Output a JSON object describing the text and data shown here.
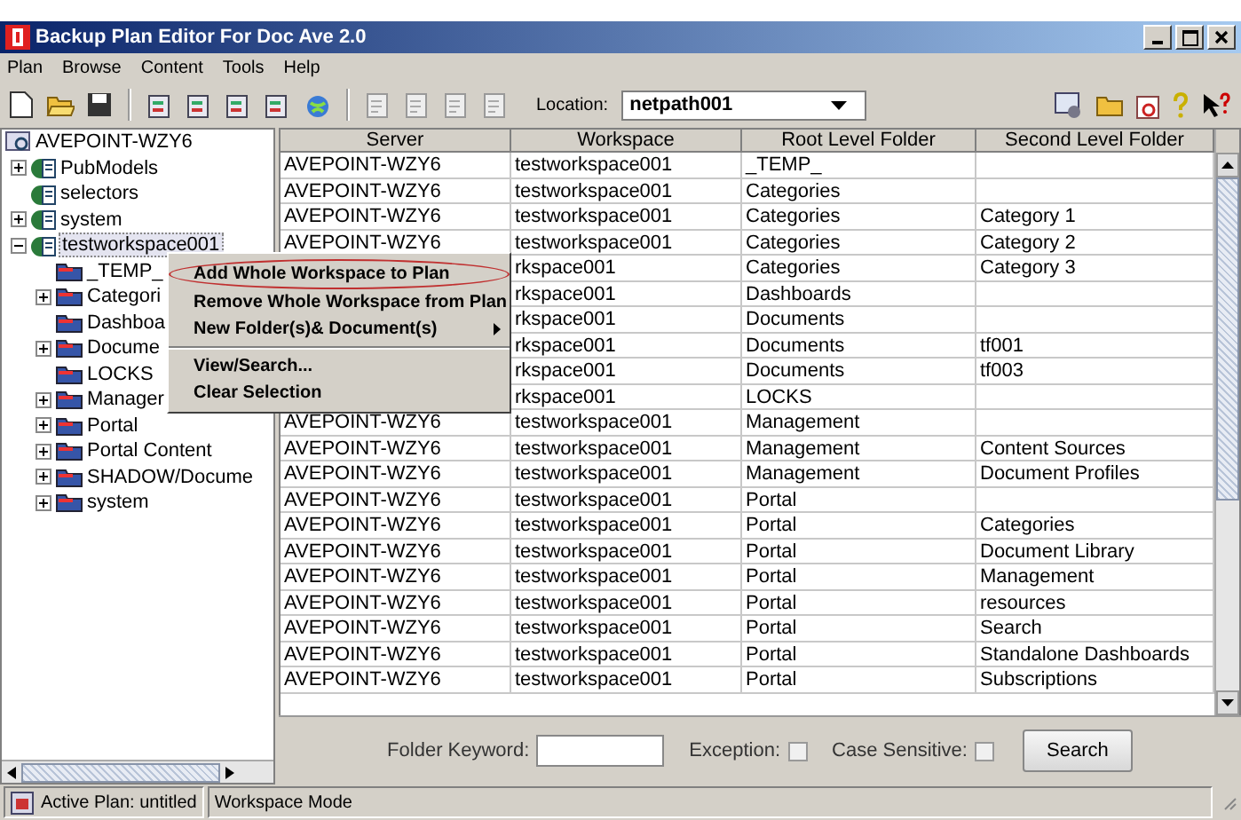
{
  "window": {
    "title": "Backup Plan Editor For Doc Ave 2.0"
  },
  "menu": [
    "Plan",
    "Browse",
    "Content",
    "Tools",
    "Help"
  ],
  "toolbar": {
    "location_label": "Location:",
    "location_value": "netpath001"
  },
  "tree": {
    "label": "AVEPOINT-WZY6",
    "selected": false,
    "children": [
      {
        "label": "PubModels",
        "kind": "workspace",
        "selected": false,
        "expanded": false
      },
      {
        "label": "selectors",
        "kind": "workspace",
        "selected": false
      },
      {
        "label": "system",
        "kind": "workspace",
        "selected": false,
        "expanded": false
      },
      {
        "label": "testworkspace001",
        "kind": "workspace",
        "selected": true,
        "expanded": true,
        "children": [
          {
            "label": "_TEMP_",
            "kind": "folder",
            "selected": false
          },
          {
            "label": "Categori",
            "kind": "folder",
            "selected": false,
            "expanded": false
          },
          {
            "label": "Dashboa",
            "kind": "folder",
            "selected": false
          },
          {
            "label": "Docume",
            "kind": "folder",
            "selected": false,
            "expanded": false
          },
          {
            "label": "LOCKS",
            "kind": "folder",
            "selected": false
          },
          {
            "label": "Manager",
            "kind": "folder",
            "selected": false,
            "expanded": false
          },
          {
            "label": "Portal",
            "kind": "folder",
            "selected": false,
            "expanded": false
          },
          {
            "label": "Portal Content",
            "kind": "folder",
            "selected": false,
            "expanded": false
          },
          {
            "label": "SHADOW/Docume",
            "kind": "folder",
            "selected": false,
            "expanded": false
          },
          {
            "label": "system",
            "kind": "folder",
            "selected": false,
            "expanded": false
          }
        ]
      }
    ]
  },
  "table": {
    "columns": [
      "Server",
      "Workspace",
      "Root Level Folder",
      "Second Level Folder"
    ],
    "rows": [
      {
        "server": "AVEPOINT-WZY6",
        "workspace": "testworkspace001",
        "root": "_TEMP_"
      },
      {
        "server": "AVEPOINT-WZY6",
        "workspace": "testworkspace001",
        "root": "Categories"
      },
      {
        "server": "AVEPOINT-WZY6",
        "workspace": "testworkspace001",
        "root": "Categories",
        "second": "Category 1"
      },
      {
        "server": "AVEPOINT-WZY6",
        "workspace": "testworkspace001",
        "root": "Categories",
        "second": "Category 2"
      },
      {
        "workspace": "rkspace001",
        "root": "Categories",
        "second": "Category 3"
      },
      {
        "workspace": "rkspace001",
        "root": "Dashboards"
      },
      {
        "workspace": "rkspace001",
        "root": "Documents"
      },
      {
        "workspace": "rkspace001",
        "root": "Documents",
        "second": "tf001"
      },
      {
        "workspace": "rkspace001",
        "root": "Documents",
        "second": "tf003"
      },
      {
        "workspace": "rkspace001",
        "root": "LOCKS"
      },
      {
        "server": "AVEPOINT-WZY6",
        "workspace": "testworkspace001",
        "root": "Management"
      },
      {
        "server": "AVEPOINT-WZY6",
        "workspace": "testworkspace001",
        "root": "Management",
        "second": "Content Sources"
      },
      {
        "server": "AVEPOINT-WZY6",
        "workspace": "testworkspace001",
        "root": "Management",
        "second": "Document Profiles"
      },
      {
        "server": "AVEPOINT-WZY6",
        "workspace": "testworkspace001",
        "root": "Portal"
      },
      {
        "server": "AVEPOINT-WZY6",
        "workspace": "testworkspace001",
        "root": "Portal",
        "second": "Categories"
      },
      {
        "server": "AVEPOINT-WZY6",
        "workspace": "testworkspace001",
        "root": "Portal",
        "second": "Document Library"
      },
      {
        "server": "AVEPOINT-WZY6",
        "workspace": "testworkspace001",
        "root": "Portal",
        "second": "Management"
      },
      {
        "server": "AVEPOINT-WZY6",
        "workspace": "testworkspace001",
        "root": "Portal",
        "second": "resources"
      },
      {
        "server": "AVEPOINT-WZY6",
        "workspace": "testworkspace001",
        "root": "Portal",
        "second": "Search"
      },
      {
        "server": "AVEPOINT-WZY6",
        "workspace": "testworkspace001",
        "root": "Portal",
        "second": "Standalone Dashboards"
      },
      {
        "server": "AVEPOINT-WZY6",
        "workspace": "testworkspace001",
        "root": "Portal",
        "second": "Subscriptions"
      }
    ]
  },
  "context_menu": {
    "items": [
      {
        "label": "Add Whole Workspace to Plan",
        "highlighted": true,
        "submenu": false,
        "separator_before": false
      },
      {
        "label": "Remove Whole Workspace from Plan",
        "highlighted": false,
        "submenu": false,
        "separator_before": false
      },
      {
        "label": "New Folder(s)& Document(s)",
        "highlighted": false,
        "submenu": true,
        "separator_before": false
      },
      {
        "label": "View/Search...",
        "highlighted": false,
        "submenu": false,
        "separator_before": true
      },
      {
        "label": "Clear Selection",
        "highlighted": false,
        "submenu": false,
        "separator_before": false
      }
    ]
  },
  "search_panel": {
    "keyword_label": "Folder Keyword:",
    "exception_label": "Exception:",
    "exception_checked": false,
    "case_label": "Case Sensitive:",
    "case_checked": false,
    "button": "Search"
  },
  "status_bar": {
    "plan": "Active Plan: untitled",
    "mode": "Workspace Mode"
  }
}
